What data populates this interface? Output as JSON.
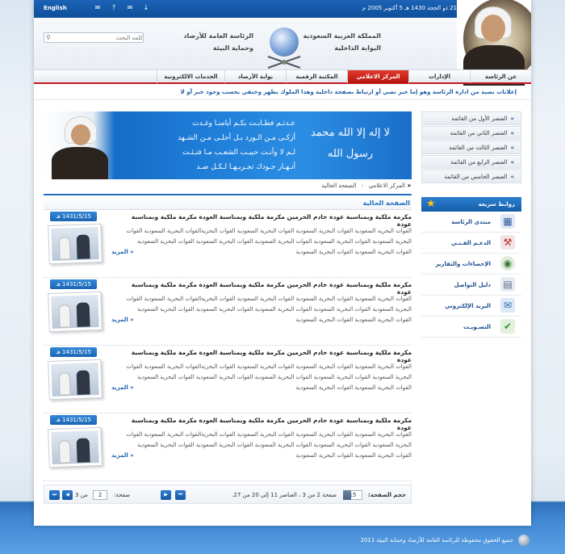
{
  "topbar": {
    "language_link": "English",
    "date": "21 ذو الحجة 1430 هـ 5 أكتوبر 2005 م",
    "tools": [
      "rss-icon",
      "help-icon",
      "mail-icon",
      "download-icon"
    ]
  },
  "header": {
    "kingdom_name": "المملكة العربية السعودية",
    "portal_name": "البوابة الداخلية",
    "authority_line1": "الرئاسة العامة للأرصاد",
    "authority_line2": "وحماية البيئة",
    "search_placeholder": "كلمه البحث"
  },
  "nav": {
    "items": [
      {
        "label": "عن الرئاسة",
        "active": false
      },
      {
        "label": "الإدارات",
        "active": false
      },
      {
        "label": "المركز الاعلامي",
        "active": true
      },
      {
        "label": "المكتبة الرقمية",
        "active": false
      },
      {
        "label": "بوابة الأرصاد",
        "active": false
      },
      {
        "label": "الخدمات الالكترونية",
        "active": false
      }
    ]
  },
  "ticker": "إعلانات نصية من ادارة الرئاسة وهو إما خبر نصي أو ارتباط بصفحة داخلية وهذا الملوك يظهر وختفي بحسب وجود خبر أو لا",
  "banner": {
    "poem_line1": "عـدتـم فطـابـت بكـم أيامنـا وغـدت",
    "poem_line2": "أزكـى مـن الـورد بـل أحلـى مـن الشـهد",
    "poem_line3": "لـم لا وأنـت حبيـب الشعـب مـا فتـئـت",
    "poem_line4": "أنـهـار جـودك تجـريـهـا لـكـل صـد",
    "calligraphy": "لا إله إلا الله محمد رسول الله"
  },
  "side_menu": {
    "items": [
      "العنصر الأول من القائمة",
      "العنصر الثاني من القائمة",
      "العنصر الثالث من القائمة",
      "العنصر الرابع من القائمة",
      "العنصر الخامس من القائمة"
    ]
  },
  "quick_links": {
    "title": "روابط سريعة",
    "items": [
      {
        "label": "منتدى الرئاسة",
        "icon": "forum-icon"
      },
      {
        "label": "الدعـم الفـنـي",
        "icon": "support-icon"
      },
      {
        "label": "الإحصاءات والتقارير",
        "icon": "stats-icon"
      },
      {
        "label": "دليل التواصل",
        "icon": "directory-icon"
      },
      {
        "label": "البريد الإلكتروني",
        "icon": "email-icon"
      },
      {
        "label": "التصـويـت",
        "icon": "vote-icon"
      }
    ]
  },
  "breadcrumb": {
    "home": "المركز الاعلامي",
    "current": "الصفحة الحالية"
  },
  "section_title": "الصفحة الحالية",
  "news": [
    {
      "date": "1431/5/15 هـ",
      "title": "مكرمة ملكية وبمناسبة عودة خادم الحرمين مكرمة ملكية وبمناسبة العودة مكرمة ملكية وبمناسبة عودة",
      "body": "القوات البحرية السعودية القوات البحرية السعودية القوات البحرية السعودية القوات البحريةالقوات البحرية السعودية القوات البحرية السعودية القوات البحرية السعودية القوات البحرية السعودية القوات البحرية السعودية القوات البحرية السعودية القوات البحرية السعودية القوات البحرية السعودية",
      "more": "« المزيد"
    },
    {
      "date": "1431/5/15 هـ",
      "title": "مكرمة ملكية وبمناسبة عودة خادم الحرمين مكرمة ملكية وبمناسبة العودة مكرمة ملكية وبمناسبة عودة",
      "body": "القوات البحرية السعودية القوات البحرية السعودية القوات البحرية السعودية القوات البحريةالقوات البحرية السعودية القوات البحرية السعودية القوات البحرية السعودية القوات البحرية السعودية القوات البحرية السعودية القوات البحرية السعودية القوات البحرية السعودية القوات البحرية السعودية",
      "more": "« المزيد"
    },
    {
      "date": "1431/5/15 هـ",
      "title": "مكرمة ملكية وبمناسبة عودة خادم الحرمين مكرمة ملكية وبمناسبة العودة مكرمة ملكية وبمناسبة عودة",
      "body": "القوات البحرية السعودية القوات البحرية السعودية القوات البحرية السعودية القوات البحريةالقوات البحرية السعودية القوات البحرية السعودية القوات البحرية السعودية القوات البحرية السعودية القوات البحرية السعودية القوات البحرية السعودية القوات البحرية السعودية القوات البحرية السعودية",
      "more": "« المزيد"
    },
    {
      "date": "1431/5/15 هـ",
      "title": "مكرمة ملكية وبمناسبة عودة خادم الحرمين مكرمة ملكية وبمناسبة العودة مكرمة ملكية وبمناسبة عودة",
      "body": "القوات البحرية السعودية القوات البحرية السعودية القوات البحرية السعودية القوات البحريةالقوات البحرية السعودية القوات البحرية السعودية القوات البحرية السعودية القوات البحرية السعودية القوات البحرية السعودية القوات البحرية السعودية القوات البحرية السعودية القوات البحرية السعودية",
      "more": "« المزيد"
    }
  ],
  "pager": {
    "page_size_label": "حجم الصفحة:",
    "page_size": "15",
    "status": "صفحة 2 من 3 ، العناصر 11 إلى 20 من 27.",
    "page_label": "صفحة:",
    "page_value": "2",
    "page_of": "من 3"
  },
  "footer": "جميع الحقوق محفوظة للرئاسة العامة للأرصاد وحماية البيئة 2011",
  "colors": {
    "brand_blue": "#1f6fc1",
    "active_red": "#c4171e",
    "topbar_blue": "#0e4f9a"
  }
}
